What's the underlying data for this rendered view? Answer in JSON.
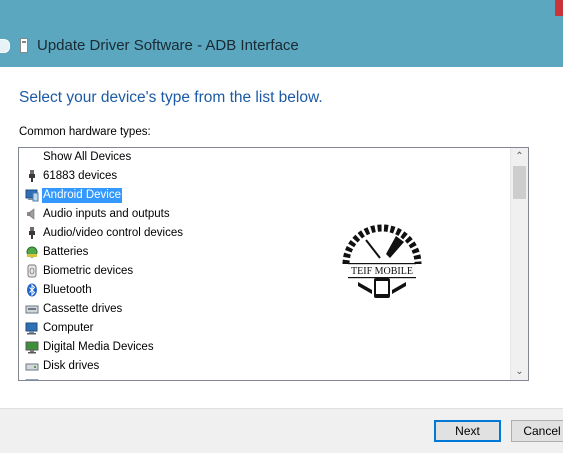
{
  "window": {
    "title": "Update Driver Software - ADB Interface"
  },
  "main": {
    "heading": "Select your device's type from the list below.",
    "list_label": "Common hardware types:",
    "items": [
      {
        "label": "Show All Devices",
        "icon": "none",
        "selected": false
      },
      {
        "label": "61883 devices",
        "icon": "plug-icon",
        "selected": false
      },
      {
        "label": "Android Device",
        "icon": "android-device-icon",
        "selected": true
      },
      {
        "label": "Audio inputs and outputs",
        "icon": "speaker-icon",
        "selected": false
      },
      {
        "label": "Audio/video control devices",
        "icon": "plug-icon",
        "selected": false
      },
      {
        "label": "Batteries",
        "icon": "battery-icon",
        "selected": false
      },
      {
        "label": "Biometric devices",
        "icon": "biometric-icon",
        "selected": false
      },
      {
        "label": "Bluetooth",
        "icon": "bluetooth-icon",
        "selected": false
      },
      {
        "label": "Cassette drives",
        "icon": "cassette-icon",
        "selected": false
      },
      {
        "label": "Computer",
        "icon": "computer-icon",
        "selected": false
      },
      {
        "label": "Digital Media Devices",
        "icon": "monitor-icon",
        "selected": false
      },
      {
        "label": "Disk drives",
        "icon": "disk-drive-icon",
        "selected": false
      },
      {
        "label": "",
        "icon": "display-adapter-icon",
        "selected": false
      }
    ]
  },
  "footer": {
    "next_label": "Next",
    "cancel_label": "Cancel"
  },
  "watermark": {
    "text": "TEIF MOBILE"
  },
  "colors": {
    "titlebar": "#5aa7bf",
    "heading": "#1c5aa6",
    "selection": "#3399ff"
  }
}
